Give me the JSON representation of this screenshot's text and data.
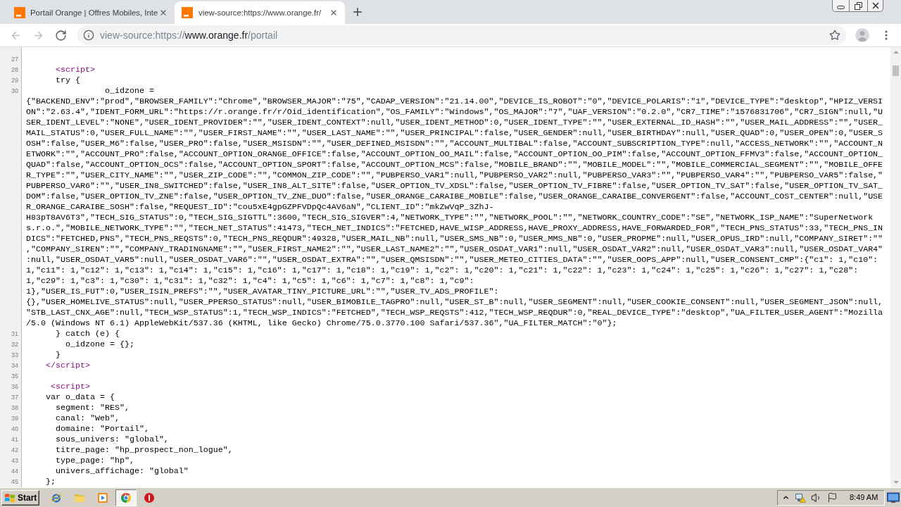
{
  "browser": {
    "tabs": [
      {
        "title": "Portail Orange | Offres Mobiles, Inte",
        "selected": false
      },
      {
        "title": "view-source:https://www.orange.fr/",
        "selected": true
      }
    ],
    "nav_buttons": [
      {
        "kind": "back",
        "disabled": true
      },
      {
        "kind": "forward",
        "disabled": true
      },
      {
        "kind": "reload",
        "disabled": false
      }
    ],
    "address": {
      "scheme": "view-source:https://",
      "host": "www.orange.fr",
      "path": "/portail"
    }
  },
  "source_view": {
    "lines": [
      {
        "number": "27"
      },
      {
        "number": "28",
        "kind": "markup",
        "text": "      <script>"
      },
      {
        "number": "29",
        "kind": "script",
        "text": "      try {"
      },
      {
        "number": "30",
        "kind": "script",
        "text": "                o_idzone = {\"BACKEND_ENV\":\"prod\",\"BROWSER_FAMILY\":\"Chrome\",\"BROWSER_MAJOR\":\"75\",\"CADAP_VERSION\":\"21.14.00\",\"DEVICE_IS_ROBOT\":\"0\",\"DEVICE_POLARIS\":\"1\",\"DEVICE_TYPE\":\"desktop\",\"HPIZ_VERSION\":\"2.63.4\",\"IDENT_FORM_URL\":\"https://r.orange.fr/r/Oid_identification\",\"OS_FAMILY\":\"Windows\",\"OS_MAJOR\":\"7\",\"UAF_VERSION\":\"0.2.0\",\"CR7_TIME\":\"1576831706\",\"CR7_SIGN\":null,\"USER_IDENT_LEVEL\":\"NONE\",\"USER_IDENT_PROVIDER\":\"\",\"USER_IDENT_CONTEXT\":null,\"USER_IDENT_METHOD\":0,\"USER_IDENT_TYPE\":\"\",\"USER_EXTERNAL_ID_HASH\":\"\",\"USER_MAIL_ADDRESS\":\"\",\"USER_MAIL_STATUS\":0,\"USER_FULL_NAME\":\"\",\"USER_FIRST_NAME\":\"\",\"USER_LAST_NAME\":\"\",\"USER_PRINCIPAL\":false,\"USER_GENDER\":null,\"USER_BIRTHDAY\":null,\"USER_QUAD\":0,\"USER_OPEN\":0,\"USER_SOSH\":false,\"USER_M6\":false,\"USER_PRO\":false,\"USER_MSISDN\":\"\",\"USER_DEFINED_MSISDN\":\"\",\"ACCOUNT_MULTIBAL\":false,\"ACCOUNT_SUBSCRIPTION_TYPE\":null,\"ACCESS_NETWORK\":\"\",\"ACCOUNT_NETWORK\":\"\",\"ACCOUNT_PRO\":false,\"ACCOUNT_OPTION_ORANGE_OFFICE\":false,\"ACCOUNT_OPTION_OO_MAIL\":false,\"ACCOUNT_OPTION_OO_PIM\":false,\"ACCOUNT_OPTION_FFMV3\":false,\"ACCOUNT_OPTION_QUAD\":false,\"ACCOUNT_OPTION_OCS\":false,\"ACCOUNT_OPTION_SPORT\":false,\"ACCOUNT_OPTION_MCS\":false,\"MOBILE_BRAND\":\"\",\"MOBILE_MODEL\":\"\",\"MOBILE_COMMERCIAL_SEGMENT\":\"\",\"MOBILE_OFFER_TYPE\":\"\",\"USER_CITY_NAME\":\"\",\"USER_ZIP_CODE\":\"\",\"COMMON_ZIP_CODE\":\"\",\"PUBPERSO_VAR1\":null,\"PUBPERSO_VAR2\":null,\"PUBPERSO_VAR3\":\"\",\"PUBPERSO_VAR4\":\"\",\"PUBPERSO_VAR5\":false,\"PUBPERSO_VAR6\":\"\",\"USER_IN8_SWITCHED\":false,\"USER_IN8_ALT_SITE\":false,\"USER_OPTION_TV_XDSL\":false,\"USER_OPTION_TV_FIBRE\":false,\"USER_OPTION_TV_SAT\":false,\"USER_OPTION_TV_SAT_DOM\":false,\"USER_OPTION_TV_ZNE\":false,\"USER_OPTION_TV_ZNE_DUO\":false,\"USER_ORANGE_CARAIBE_MOBILE\":false,\"USER_ORANGE_CARAIBE_CONVERGENT\":false,\"ACCOUNT_COST_CENTER\":null,\"USER_ORANGE_CARAIBE_SOSH\":false,\"REQUEST_ID\":\"cou5xE4gpGZPFVDpQc4AV6aN\",\"CLIENT_ID\":\"mkZwVqP_3ZhJ-H83pT8AV6T3\",\"TECH_SIG_STATUS\":0,\"TECH_SIG_SIGTTL\":3600,\"TECH_SIG_SIGVER\":4,\"NETWORK_TYPE\":\"\",\"NETWORK_POOL\":\"\",\"NETWORK_COUNTRY_CODE\":\"SE\",\"NETWORK_ISP_NAME\":\"SuperNetwork s.r.o.\",\"MOBILE_NETWORK_TYPE\":\"\",\"TECH_NET_STATUS\":41473,\"TECH_NET_INDICS\":\"FETCHED,HAVE_WISP_ADDRESS,HAVE_PROXY_ADDRESS,HAVE_FORWARDED_FOR\",\"TECH_PNS_STATUS\":33,\"TECH_PNS_INDICS\":\"FETCHED,PNS\",\"TECH_PNS_REQSTS\":0,\"TECH_PNS_REQDUR\":49328,\"USER_MAIL_NB\":null,\"USER_SMS_NB\":0,\"USER_MMS_NB\":0,\"USER_PROPME\":null,\"USER_OPUS_IRD\":null,\"COMPANY_SIRET\":\"\",\"COMPANY_SIREN\":\"\",\"COMPANY_TRADINGNAME\":\"\",\"USER_FIRST_NAME2\":\"\",\"USER_LAST_NAME2\":\"\",\"USER_OSDAT_VAR1\":null,\"USER_OSDAT_VAR2\":null,\"USER_OSDAT_VAR3\":null,\"USER_OSDAT_VAR4\":null,\"USER_OSDAT_VAR5\":null,\"USER_OSDAT_VAR6\":\"\",\"USER_OSDAT_EXTRA\":\"\",\"USER_QMSISDN\":\"\",\"USER_METEO_CITIES_DATA\":\"\",\"USER_OOPS_APP\":null,\"USER_CONSENT_CMP\":{\"c1\": 1,\"c10\": 1,\"c11\": 1,\"c12\": 1,\"c13\": 1,\"c14\": 1,\"c15\": 1,\"c16\": 1,\"c17\": 1,\"c18\": 1,\"c19\": 1,\"c2\": 1,\"c20\": 1,\"c21\": 1,\"c22\": 1,\"c23\": 1,\"c24\": 1,\"c25\": 1,\"c26\": 1,\"c27\": 1,\"c28\": 1,\"c29\": 1,\"c3\": 1,\"c30\": 1,\"c31\": 1,\"c32\": 1,\"c4\": 1,\"c5\": 1,\"c6\": 1,\"c7\": 1,\"c8\": 1,\"c9\": 1},\"USER_IS_FUT\":0,\"USER_ISIN_PREFS\":\"\",\"USER_AVATAR_TINY_PICTURE_URL\":\"\",\"USER_TV_ADS_PROFILE\": {},\"USER_HOMELIVE_STATUS\":null,\"USER_PPERSO_STATUS\":null,\"USER_BIMOBILE_TAGPRO\":null,\"USER_ST_B\":null,\"USER_SEGMENT\":null,\"USER_COOKIE_CONSENT\":null,\"USER_SEGMENT_JSON\":null,\"STB_LAST_CNX_AGE\":null,\"TECH_WSP_STATUS\":1,\"TECH_WSP_INDICS\":\"FETCHED\",\"TECH_WSP_REQSTS\":412,\"TECH_WSP_REQDUR\":0,\"REAL_DEVICE_TYPE\":\"desktop\",\"UA_FILTER_USER_AGENT\":\"Mozilla/5.0 (Windows NT 6.1) AppleWebKit/537.36 (KHTML, like Gecko) Chrome/75.0.3770.100 Safari/537.36\",\"UA_FILTER_MATCH\":\"0\"};"
      },
      {
        "number": "31",
        "kind": "script",
        "text": "      } catch (e) {"
      },
      {
        "number": "32",
        "kind": "script",
        "text": "        o_idzone = {};"
      },
      {
        "number": "33",
        "kind": "script",
        "text": "      }"
      },
      {
        "number": "34",
        "kind": "markup",
        "text": "    </script>"
      },
      {
        "number": "35"
      },
      {
        "number": "36",
        "kind": "markup",
        "text": "     <script>"
      },
      {
        "number": "37",
        "kind": "script",
        "text": "    var o_data = {"
      },
      {
        "number": "38",
        "kind": "script",
        "text": "      segment: \"RES\","
      },
      {
        "number": "39",
        "kind": "script",
        "text": "      canal: \"Web\","
      },
      {
        "number": "40",
        "kind": "script",
        "text": "      domaine: \"Portail\","
      },
      {
        "number": "41",
        "kind": "script",
        "text": "      sous_univers: \"global\","
      },
      {
        "number": "42",
        "kind": "script",
        "text": "      titre_page: \"hp_prospect_non_logue\","
      },
      {
        "number": "43",
        "kind": "script",
        "text": "      type_page: \"hp\","
      },
      {
        "number": "44",
        "kind": "script",
        "text": "      univers_affichage: \"global\""
      },
      {
        "number": "45",
        "kind": "script",
        "text": "    };"
      }
    ]
  },
  "taskbar": {
    "start": "Start",
    "apps": [
      {
        "kind": "orbit",
        "selected": false
      },
      {
        "kind": "folder",
        "selected": false
      },
      {
        "kind": "player",
        "selected": false
      },
      {
        "kind": "ring",
        "selected": true
      },
      {
        "kind": "stop",
        "selected": false
      }
    ],
    "clock": "8:49 AM"
  }
}
